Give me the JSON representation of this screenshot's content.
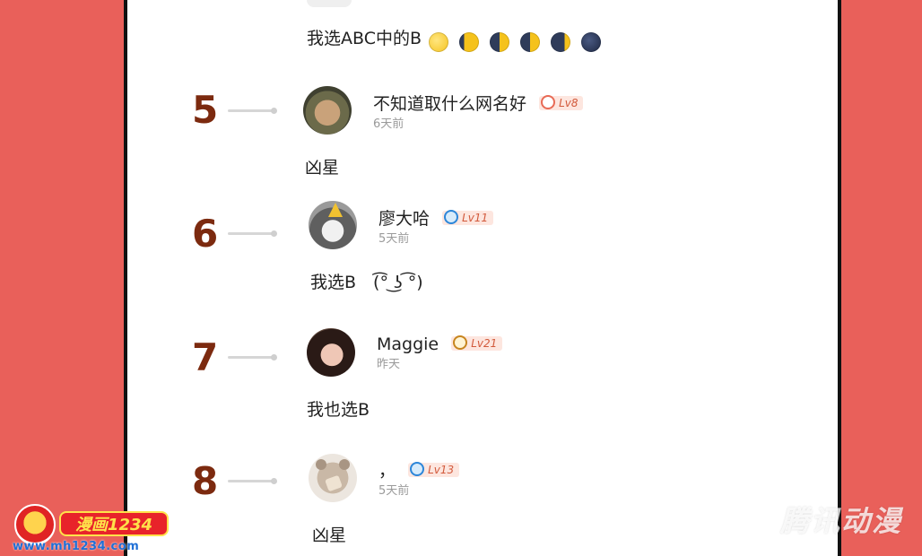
{
  "top_comment": {
    "text": "我选ABC中的B"
  },
  "entries": [
    {
      "rank": "5",
      "username": "不知道取什么网名好",
      "level": "Lv8",
      "time": "6天前",
      "content": "凶星"
    },
    {
      "rank": "6",
      "username": "廖大哈",
      "level": "Lv11",
      "time": "5天前",
      "content": "我选B　(͡° ͜ʖ ͡°)"
    },
    {
      "rank": "7",
      "username": "Maggie",
      "level": "Lv21",
      "time": "昨天",
      "content": "我也选B"
    },
    {
      "rank": "8",
      "username": "，",
      "level": "Lv13",
      "time": "5天前",
      "content": "凶星"
    }
  ],
  "branding": {
    "logo_text": "漫画1234",
    "logo_url": "www.mh1234.com",
    "watermark": "腾讯动漫"
  },
  "colors": {
    "background": "#e9605a",
    "rank_color": "#7c2a0f",
    "level_text": "#d25a3c"
  }
}
